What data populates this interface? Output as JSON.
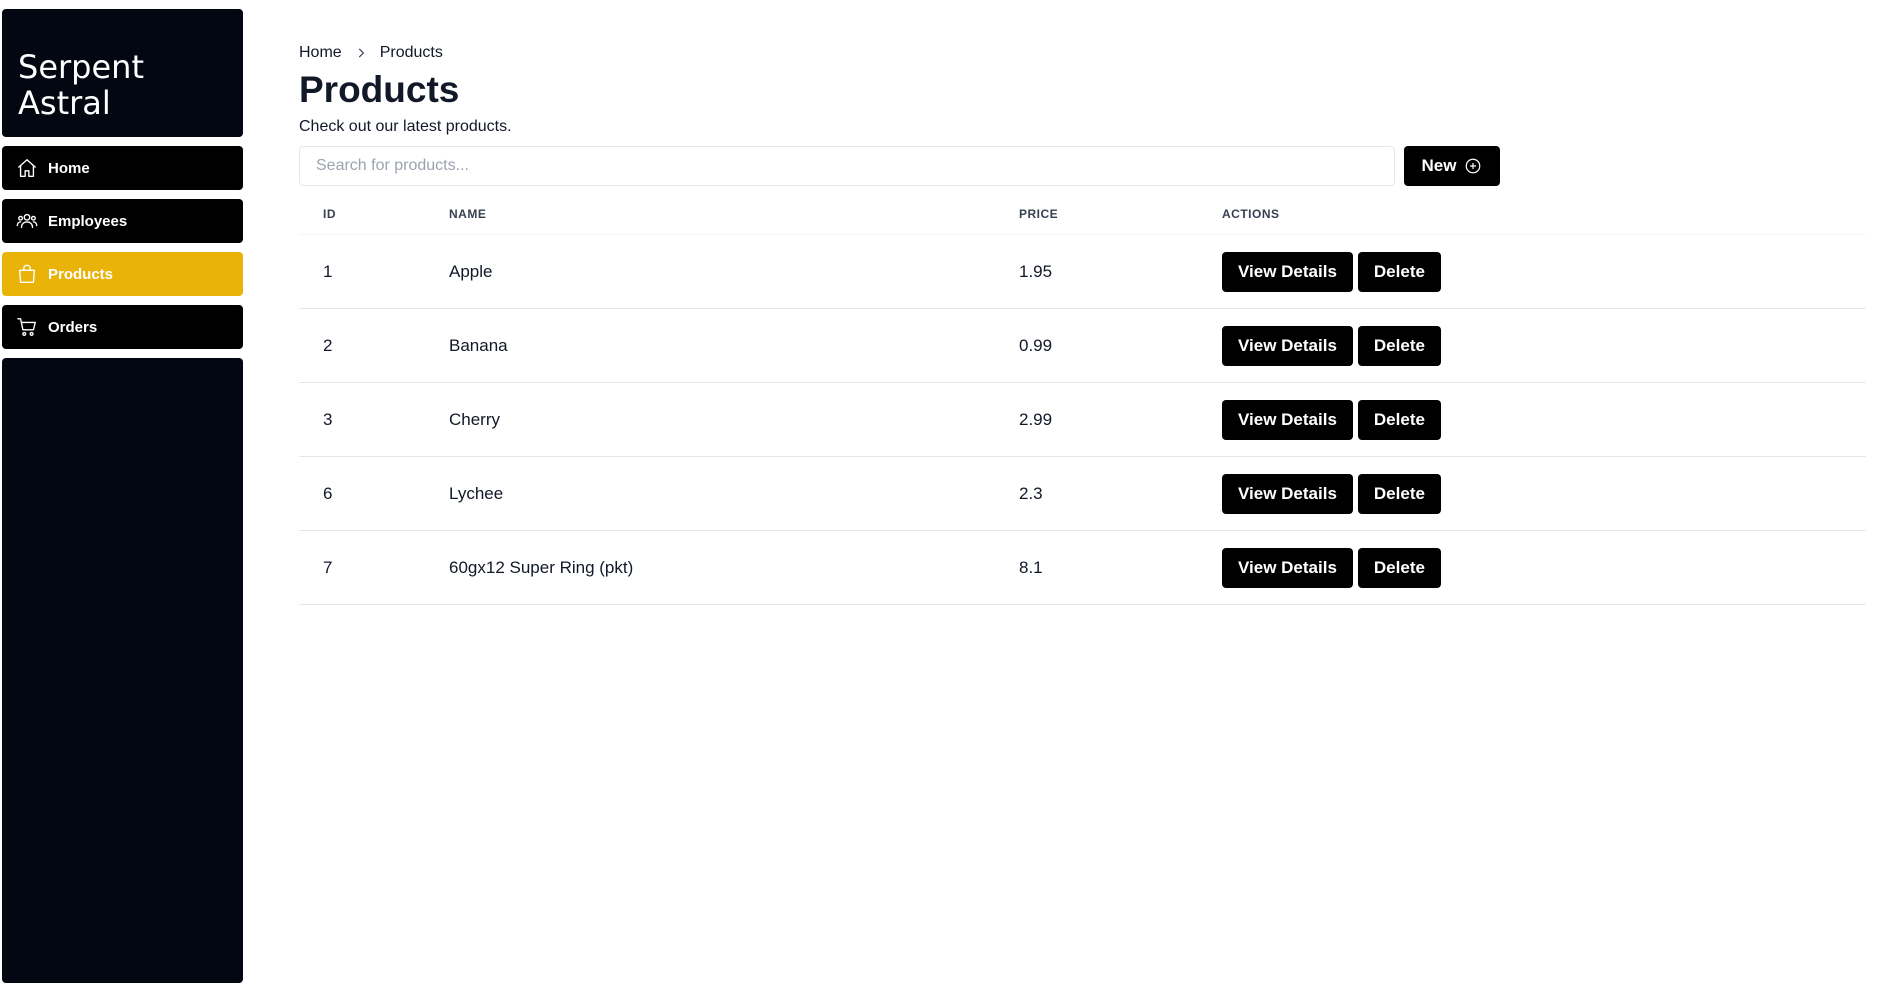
{
  "brand": {
    "line1": "Serpent",
    "line2": "Astral"
  },
  "sidebar": {
    "items": [
      {
        "label": "Home",
        "icon": "home-icon",
        "active": false
      },
      {
        "label": "Employees",
        "icon": "users-icon",
        "active": false
      },
      {
        "label": "Products",
        "icon": "shopping-bag-icon",
        "active": true
      },
      {
        "label": "Orders",
        "icon": "cart-icon",
        "active": false
      }
    ]
  },
  "breadcrumb": {
    "home": "Home",
    "current": "Products"
  },
  "page": {
    "title": "Products",
    "subtitle": "Check out our latest products."
  },
  "search": {
    "placeholder": "Search for products...",
    "value": ""
  },
  "toolbar": {
    "new_label": "New"
  },
  "table": {
    "columns": [
      "ID",
      "NAME",
      "PRICE",
      "ACTIONS"
    ],
    "rows": [
      {
        "id": "1",
        "name": "Apple",
        "price": "1.95"
      },
      {
        "id": "2",
        "name": "Banana",
        "price": "0.99"
      },
      {
        "id": "3",
        "name": "Cherry",
        "price": "2.99"
      },
      {
        "id": "6",
        "name": "Lychee",
        "price": "2.3"
      },
      {
        "id": "7",
        "name": "60gx12 Super Ring (pkt)",
        "price": "8.1"
      }
    ],
    "view_label": "View Details",
    "delete_label": "Delete"
  },
  "colors": {
    "accent": "#eab308",
    "sidebar_bg": "#030712",
    "button_bg": "#000000"
  }
}
